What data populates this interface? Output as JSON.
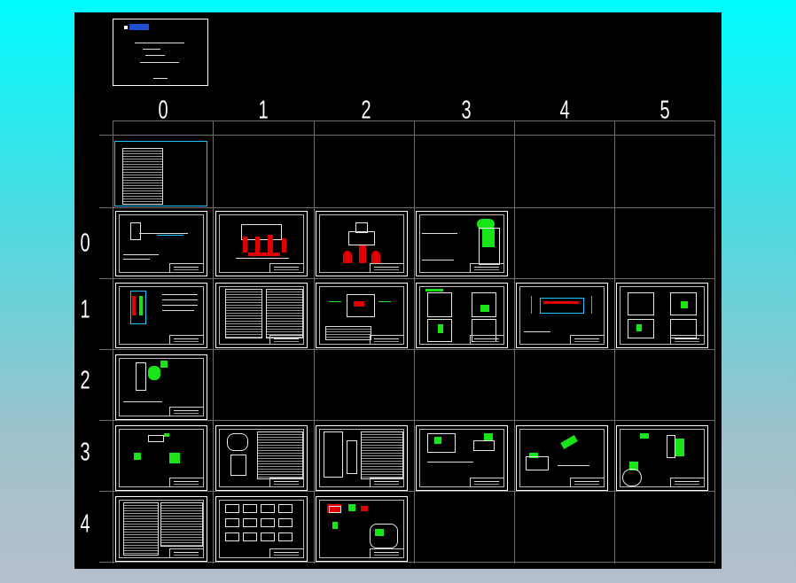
{
  "column_headers": [
    "0",
    "1",
    "2",
    "3",
    "4",
    "5"
  ],
  "row_headers": [
    "0",
    "1",
    "2",
    "3",
    "4"
  ],
  "colors": {
    "canvas": "#000000",
    "grid": "#6e6e6e",
    "sheet_border": "#ffffff",
    "accent_red": "#e00000",
    "accent_green": "#18e418",
    "accent_cyan": "#23c2ff",
    "window_gradient_top": "#00fcfe",
    "window_gradient_bottom": "#b5bfcb"
  },
  "icons": [
    "cover-logo-icon"
  ]
}
